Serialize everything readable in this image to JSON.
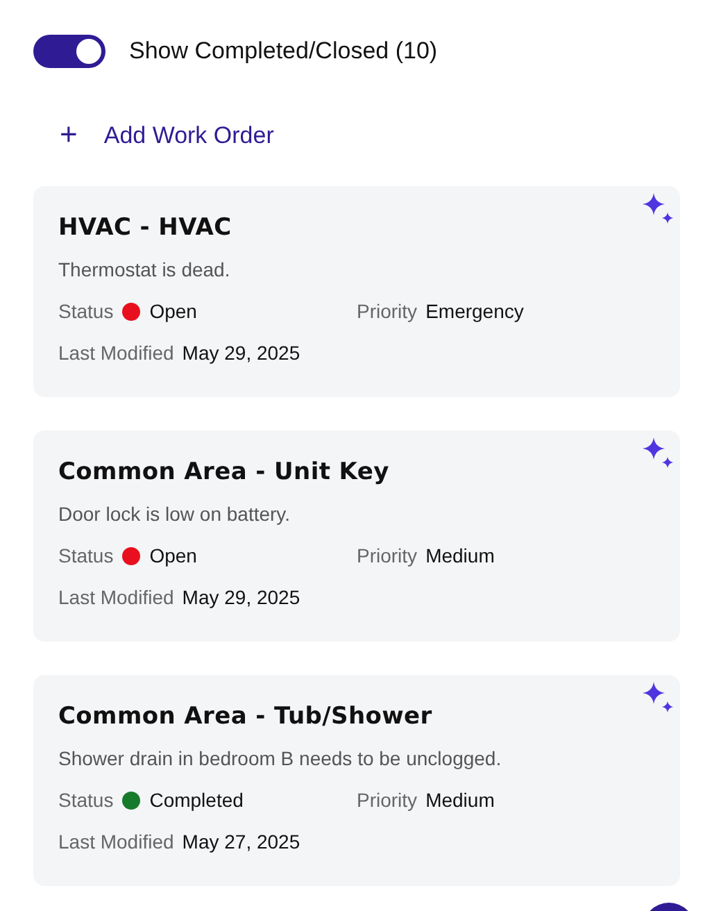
{
  "toggle": {
    "label": "Show Completed/Closed (10)",
    "on": true
  },
  "add_button": {
    "icon": "+",
    "label": "Add Work Order"
  },
  "work_orders": [
    {
      "title": "HVAC - HVAC",
      "description": "Thermostat is dead.",
      "status_label": "Status",
      "status": "Open",
      "color": "#e8101e",
      "priority_label": "Priority",
      "priority": "Emergency",
      "modified_label": "Last Modified",
      "modified": "May 29, 2025"
    },
    {
      "title": "Common Area - Unit Key",
      "description": "Door lock is low on battery.",
      "status_label": "Status",
      "status": "Open",
      "color": "#e8101e",
      "priority_label": "Priority",
      "priority": "Medium",
      "modified_label": "Last Modified",
      "modified": "May 29, 2025"
    },
    {
      "title": "Common Area - Tub/Shower",
      "description": "Shower drain in bedroom B needs to be unclogged.",
      "status_label": "Status",
      "status": "Completed",
      "color": "#157a2c",
      "priority_label": "Priority",
      "priority": "Medium",
      "modified_label": "Last Modified",
      "modified": "May 27, 2025"
    }
  ]
}
